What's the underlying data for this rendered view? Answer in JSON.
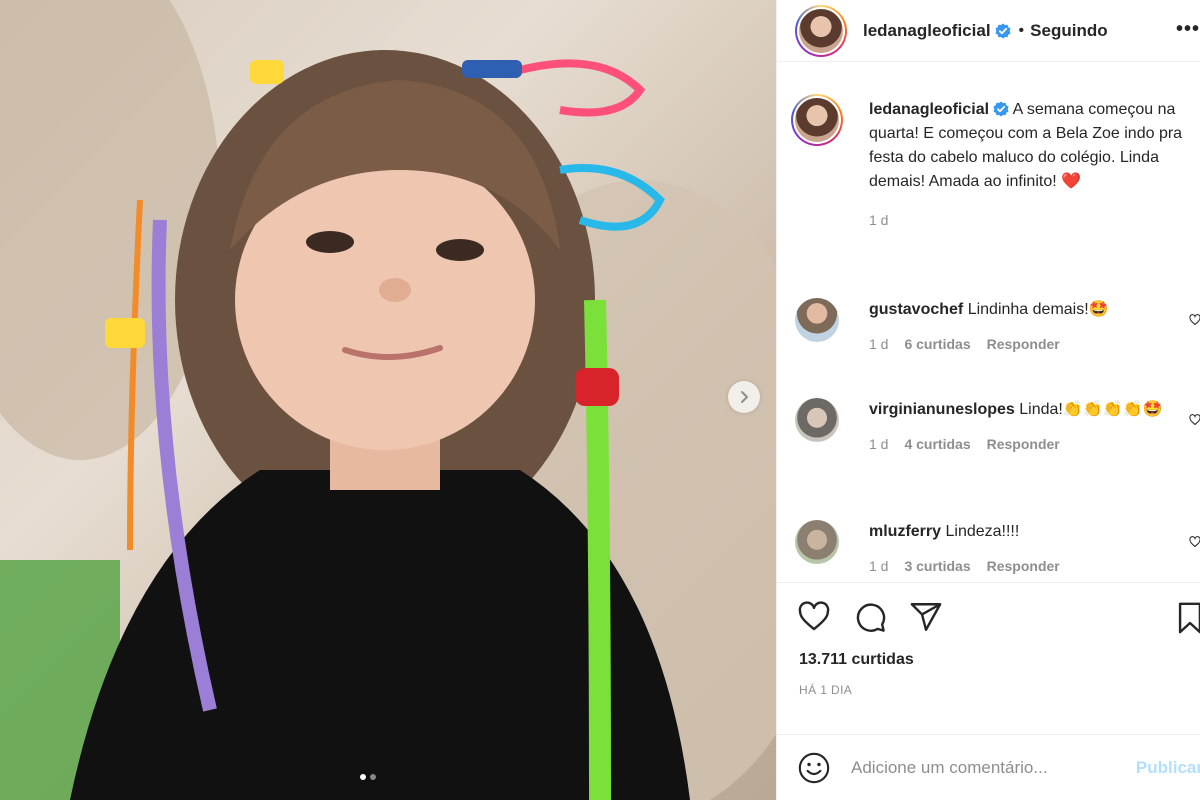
{
  "post": {
    "username": "ledanagleoficial",
    "follow_state": "Seguindo",
    "separator": "•",
    "caption": "A semana começou na quarta! E começou com a Bela Zoe indo pra festa do cabelo maluco do colégio. Linda demais! Amada ao infinito! ❤️",
    "caption_time": "1 d",
    "likes": "13.711 curtidas",
    "date": "HÁ 1 DIA",
    "carousel": {
      "count": 2,
      "active": 1
    }
  },
  "comments": [
    {
      "username": "gustavochef",
      "text": "Lindinha demais!🤩",
      "time": "1 d",
      "likes": "6 curtidas",
      "reply": "Responder"
    },
    {
      "username": "virginianuneslopes",
      "text": "Linda!👏👏👏👏🤩",
      "time": "1 d",
      "likes": "4 curtidas",
      "reply": "Responder"
    },
    {
      "username": "mluzferry",
      "text": "Lindeza!!!!",
      "time": "1 d",
      "likes": "3 curtidas",
      "reply": "Responder"
    }
  ],
  "composer": {
    "placeholder": "Adicione um comentário...",
    "publish_label": "Publicar"
  },
  "icons": {
    "header_more": "more-options-icon",
    "verified": "verified-badge-icon",
    "like": "heart-icon",
    "comment": "comment-icon",
    "share": "share-icon",
    "save": "bookmark-icon",
    "emoji": "emoji-icon",
    "next": "chevron-right-icon"
  },
  "colors": {
    "verified": "#3897f0",
    "publish_disabled": "#b2dffc",
    "heart": "#ed4956"
  }
}
